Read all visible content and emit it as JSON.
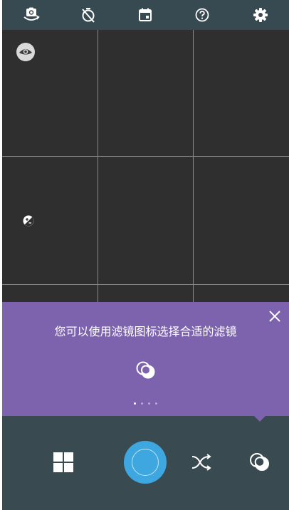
{
  "top_toolbar": {
    "icons": [
      "switch-camera-icon",
      "timer-off-icon",
      "calendar-icon",
      "help-icon",
      "settings-icon"
    ]
  },
  "viewfinder": {
    "grid": "3x3",
    "overlay_icons": [
      "eye-icon",
      "exposure-icon"
    ]
  },
  "tip": {
    "text": "您可以使用滤镜图标选择合适的滤镜",
    "icon": "filter-icon",
    "page_count": 4,
    "active_page": 1,
    "background": "#7d62ad"
  },
  "bottom_bar": {
    "icons": [
      "gallery-grid-icon",
      "shutter-button",
      "shuffle-icon",
      "filter-icon"
    ],
    "shutter_color": "#3fa7df",
    "background": "#3a4a51"
  }
}
